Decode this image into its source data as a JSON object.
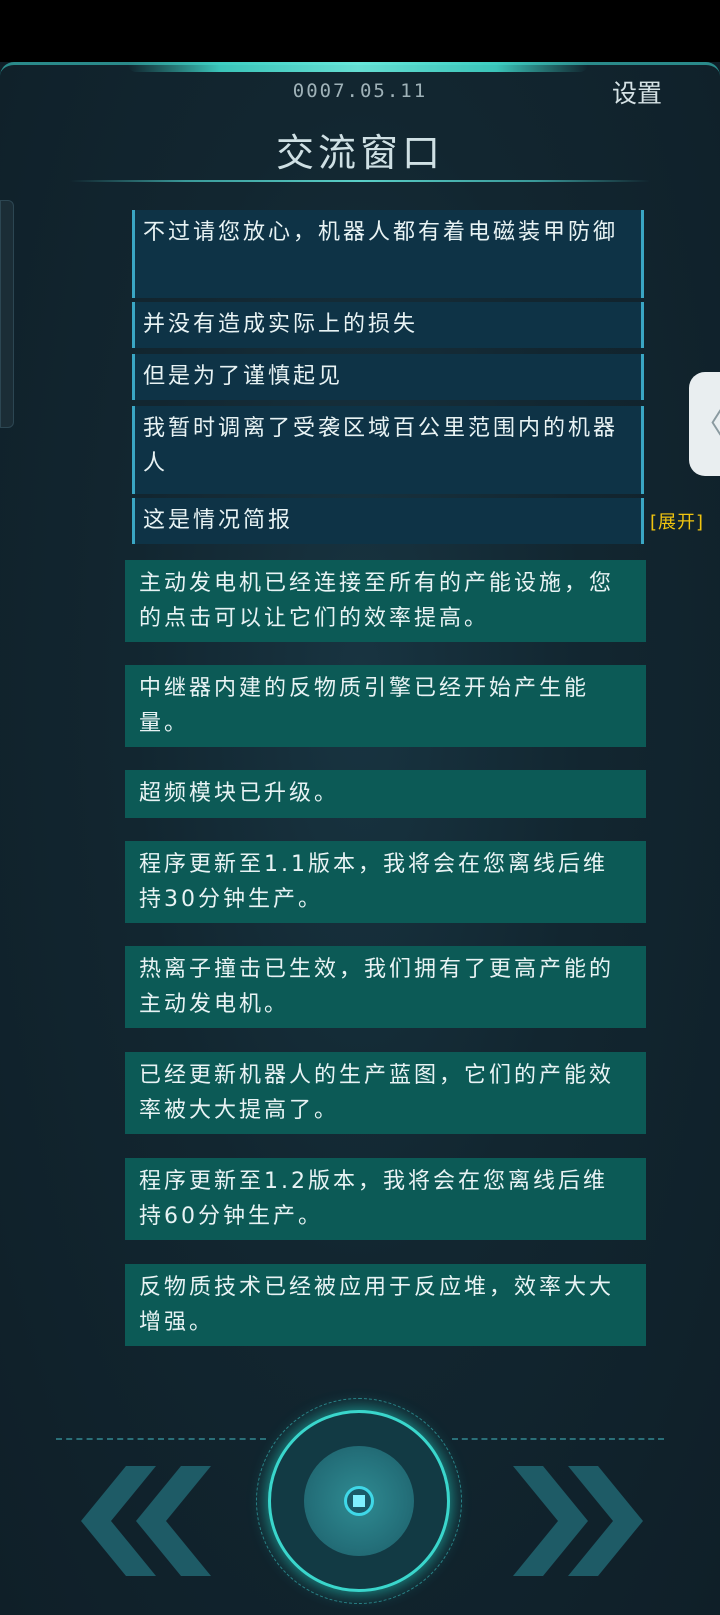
{
  "header": {
    "date": "0007.05.11",
    "settings_label": "设置",
    "title": "交流窗口"
  },
  "messages": [
    {
      "type": "system",
      "text": "不过请您放心，机器人都有着电磁装甲防御"
    },
    {
      "type": "system",
      "text": "并没有造成实际上的损失"
    },
    {
      "type": "system",
      "text": "但是为了谨慎起见"
    },
    {
      "type": "system",
      "text": "我暂时调离了受袭区域百公里范围内的机器人"
    },
    {
      "type": "system",
      "text": "这是情况简报",
      "expand_label": "[展开]"
    },
    {
      "type": "bot",
      "text": "主动发电机已经连接至所有的产能设施，您的点击可以让它们的效率提高。"
    },
    {
      "type": "bot",
      "text": "中继器内建的反物质引擎已经开始产生能量。"
    },
    {
      "type": "bot",
      "text": "超频模块已升级。"
    },
    {
      "type": "bot",
      "text": "程序更新至1.1版本，我将会在您离线后维持30分钟生产。"
    },
    {
      "type": "bot",
      "text": "热离子撞击已生效，我们拥有了更高产能的主动发电机。"
    },
    {
      "type": "bot",
      "text": "已经更新机器人的生产蓝图，它们的产能效率被大大提高了。"
    },
    {
      "type": "bot",
      "text": "程序更新至1.2版本，我将会在您离线后维持60分钟生产。"
    },
    {
      "type": "bot",
      "text": "反物质技术已经被应用于反应堆，效率大大增强。"
    }
  ],
  "side_tab": {
    "icon": "chevron-left-icon",
    "glyph": "〈"
  },
  "nav": {
    "prev_icon": "double-chevron-left-icon",
    "home_icon": "home-core-icon",
    "next_icon": "double-chevron-right-icon"
  },
  "colors": {
    "accent": "#3ad6cc",
    "system_bubble": "#0e3346",
    "bot_bubble": "#0c5a56",
    "expand": "#f1c40f"
  }
}
